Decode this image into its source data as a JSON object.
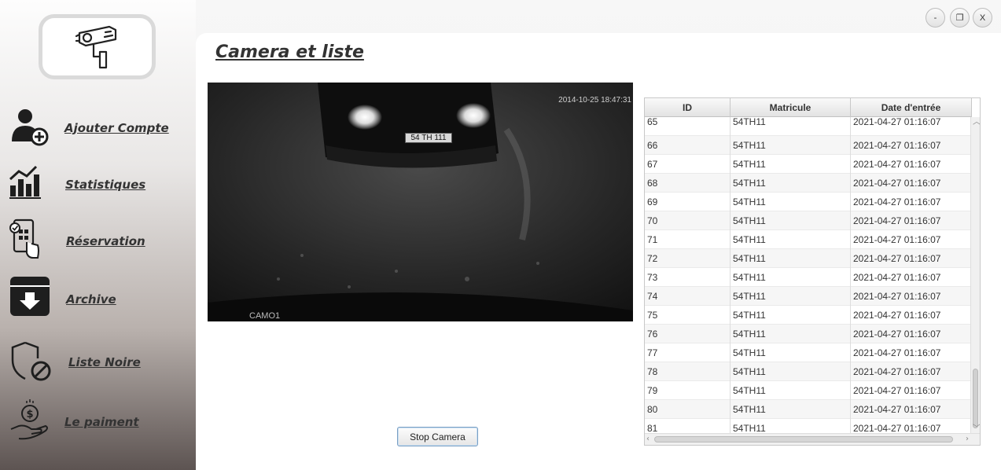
{
  "sidebar": {
    "items": [
      {
        "label": "Ajouter Compte",
        "icon": "add-user-icon"
      },
      {
        "label": "Statistiques",
        "icon": "bar-chart-icon"
      },
      {
        "label": "Réservation",
        "icon": "phone-reservation-icon"
      },
      {
        "label": "Archive",
        "icon": "archive-download-icon"
      },
      {
        "label": "Liste Noire",
        "icon": "shield-blocked-icon"
      },
      {
        "label": "Le paiment",
        "icon": "hand-money-icon"
      }
    ]
  },
  "window_controls": {
    "minimize": "-",
    "maximize": "❐",
    "close": "X"
  },
  "main": {
    "title": "Camera et liste",
    "camera": {
      "timestamp": "2014-10-25 18:47:31",
      "label": "CAMO1",
      "plate": "54  TH  111"
    },
    "stop_button": "Stop Camera"
  },
  "table": {
    "columns": [
      "ID",
      "Matricule",
      "Date d'entrée"
    ],
    "rows": [
      [
        "65",
        "54TH11",
        "2021-04-27 01:16:07"
      ],
      [
        "66",
        "54TH11",
        "2021-04-27 01:16:07"
      ],
      [
        "67",
        "54TH11",
        "2021-04-27 01:16:07"
      ],
      [
        "68",
        "54TH11",
        "2021-04-27 01:16:07"
      ],
      [
        "69",
        "54TH11",
        "2021-04-27 01:16:07"
      ],
      [
        "70",
        "54TH11",
        "2021-04-27 01:16:07"
      ],
      [
        "71",
        "54TH11",
        "2021-04-27 01:16:07"
      ],
      [
        "72",
        "54TH11",
        "2021-04-27 01:16:07"
      ],
      [
        "73",
        "54TH11",
        "2021-04-27 01:16:07"
      ],
      [
        "74",
        "54TH11",
        "2021-04-27 01:16:07"
      ],
      [
        "75",
        "54TH11",
        "2021-04-27 01:16:07"
      ],
      [
        "76",
        "54TH11",
        "2021-04-27 01:16:07"
      ],
      [
        "77",
        "54TH11",
        "2021-04-27 01:16:07"
      ],
      [
        "78",
        "54TH11",
        "2021-04-27 01:16:07"
      ],
      [
        "79",
        "54TH11",
        "2021-04-27 01:16:07"
      ],
      [
        "80",
        "54TH11",
        "2021-04-27 01:16:07"
      ],
      [
        "81",
        "54TH11",
        "2021-04-27 01:16:07"
      ]
    ]
  }
}
